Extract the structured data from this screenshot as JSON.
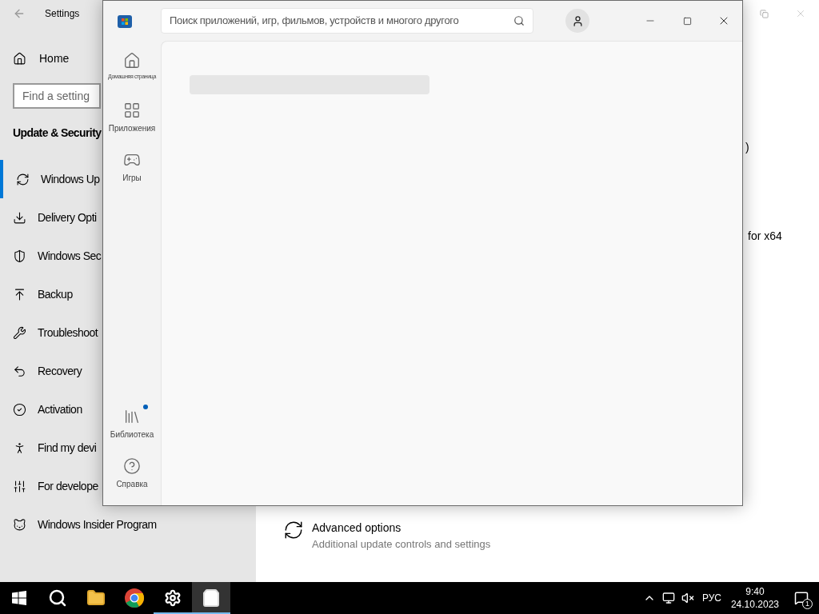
{
  "settings": {
    "title": "Settings",
    "home": "Home",
    "search": {
      "placeholder": "Find a setting"
    },
    "section": "Update & Security",
    "items": [
      {
        "label": "Windows Up",
        "selected": true
      },
      {
        "label": "Delivery Opti",
        "selected": false
      },
      {
        "label": "Windows Sec",
        "selected": false
      },
      {
        "label": "Backup",
        "selected": false
      },
      {
        "label": "Troubleshoot",
        "selected": false
      },
      {
        "label": "Recovery",
        "selected": false
      },
      {
        "label": "Activation",
        "selected": false
      },
      {
        "label": "Find my devi",
        "selected": false
      },
      {
        "label": "For develope",
        "selected": false
      },
      {
        "label": "Windows Insider Program",
        "selected": false
      }
    ],
    "content_fragments": [
      ")",
      "for x64"
    ],
    "advanced": {
      "title": "Advanced options",
      "subtitle": "Additional update controls and settings"
    }
  },
  "store": {
    "search": {
      "placeholder": "Поиск приложений, игр, фильмов, устройств и многого другого"
    },
    "nav_top": [
      {
        "label": "Домашняя страница",
        "notification": false
      },
      {
        "label": "Приложения",
        "notification": false
      },
      {
        "label": "Игры",
        "notification": false
      }
    ],
    "nav_bottom": [
      {
        "label": "Библиотека",
        "notification": true
      },
      {
        "label": "Справка",
        "notification": false
      }
    ]
  },
  "taskbar": {
    "buttons": [
      {
        "kind": "start",
        "running": false,
        "selected": false
      },
      {
        "kind": "search",
        "running": false,
        "selected": false
      },
      {
        "kind": "explorer",
        "running": false,
        "selected": false
      },
      {
        "kind": "chrome",
        "running": false,
        "selected": false
      },
      {
        "kind": "settings",
        "running": true,
        "selected": false
      },
      {
        "kind": "store",
        "running": true,
        "selected": true
      }
    ],
    "language": "РУС",
    "time": "9:40",
    "date": "24.10.2023",
    "notifications": "1"
  }
}
